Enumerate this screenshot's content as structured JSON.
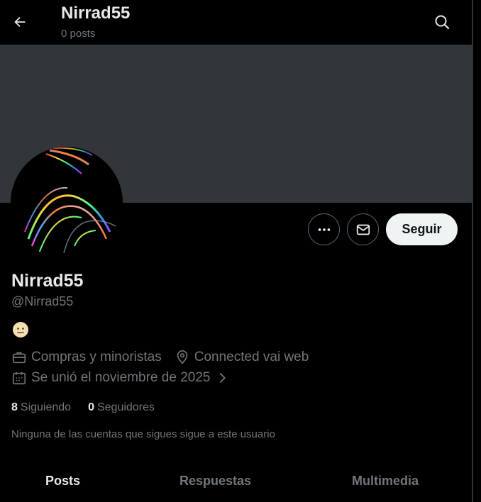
{
  "header": {
    "name": "Nirrad55",
    "posts_count": "0 posts"
  },
  "profile": {
    "display_name": "Nirrad55",
    "handle": "@Nirrad55",
    "bio_emoji": "neutral-face",
    "category": "Compras y minoristas",
    "location": "Connected vai web",
    "joined": "Se unió el noviembre de 2025",
    "following_count": "8",
    "following_label": "Siguiendo",
    "followers_count": "0",
    "followers_label": "Seguidores",
    "notice": "Ninguna de las cuentas que sigues sigue a este usuario"
  },
  "actions": {
    "follow_label": "Seguir"
  },
  "tabs": [
    {
      "label": "Posts",
      "active": true
    },
    {
      "label": "Respuestas",
      "active": false
    },
    {
      "label": "Multimedia",
      "active": false
    }
  ],
  "colors": {
    "background": "#000000",
    "banner": "#333639",
    "text_primary": "#e7e9ea",
    "text_secondary": "#71767b",
    "button_light": "#eff3f4"
  }
}
